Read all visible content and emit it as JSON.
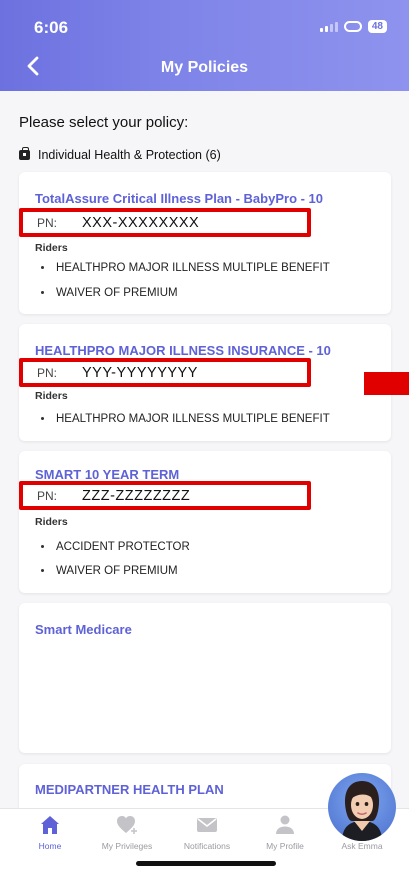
{
  "status": {
    "time": "6:06",
    "battery": "48"
  },
  "header": {
    "title": "My Policies"
  },
  "prompt": "Please select your policy:",
  "group": {
    "label": "Individual Health & Protection (6)"
  },
  "policies": [
    {
      "title": "TotalAssure Critical Illness Plan - BabyPro - 10",
      "pn_label": "PN:",
      "pn_value": "XXX-XXXXXXXX",
      "riders_label": "Riders",
      "riders": [
        "HEALTHPRO MAJOR ILLNESS MULTIPLE BENEFIT",
        "WAIVER OF PREMIUM"
      ]
    },
    {
      "title": "HEALTHPRO MAJOR ILLNESS INSURANCE - 10",
      "pn_label": "PN:",
      "pn_value": "YYY-YYYYYYYY",
      "riders_label": "Riders",
      "riders": [
        "HEALTHPRO MAJOR ILLNESS MULTIPLE BENEFIT"
      ]
    },
    {
      "title": "SMART 10 YEAR TERM",
      "pn_label": "PN:",
      "pn_value": "ZZZ-ZZZZZZZZ",
      "riders_label": "Riders",
      "riders": [
        "ACCIDENT PROTECTOR",
        "WAIVER OF PREMIUM"
      ]
    },
    {
      "title": "Smart Medicare"
    },
    {
      "title": "MEDIPARTNER HEALTH PLAN"
    }
  ],
  "nav": {
    "home": "Home",
    "privileges": "My Privileges",
    "notifications": "Notifications",
    "profile": "My Profile",
    "ask": "Ask Emma"
  },
  "colors": {
    "accent": "#5e62d6",
    "redaction": "#e10000"
  }
}
